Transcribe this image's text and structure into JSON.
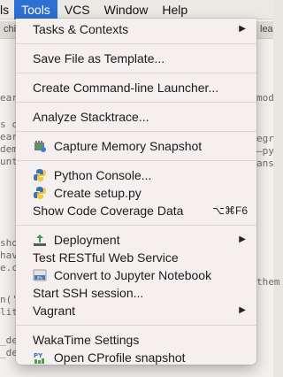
{
  "menubar": {
    "items": [
      "ls",
      "Tools",
      "VCS",
      "Window",
      "Help"
    ]
  },
  "background": {
    "tabs": [
      "chi",
      "lear"
    ],
    "lines": [
      {
        "text": "ear",
        "side": "left"
      },
      {
        "text": "mod",
        "side": "right"
      },
      {
        "text": "s c",
        "side": "left"
      },
      {
        "text": "ear",
        "side": "left"
      },
      {
        "text": "egr",
        "side": "right"
      },
      {
        "text": "dem",
        "side": "left"
      },
      {
        "text": "—py",
        "side": "right"
      },
      {
        "text": "unt",
        "side": "left"
      },
      {
        "text": "ans",
        "side": "right"
      },
      {
        "text": "sho",
        "side": "left"
      },
      {
        "text": "hav",
        "side": "left"
      },
      {
        "text": "them",
        "side": "right"
      },
      {
        "text": "e.c",
        "side": "left"
      },
      {
        "text": "n('",
        "side": "left"
      },
      {
        "text": "lit",
        "side": "left"
      },
      {
        "text": "_de",
        "side": "left"
      },
      {
        "text": "_de",
        "side": "left"
      }
    ]
  },
  "menu": {
    "tasks": "Tasks & Contexts",
    "save_template": "Save File as Template...",
    "cmdline": "Create Command-line Launcher...",
    "stacktrace": "Analyze Stacktrace...",
    "memory": "Capture Memory Snapshot",
    "python_console": "Python Console...",
    "setup_py": "Create setup.py",
    "coverage": "Show Code Coverage Data",
    "coverage_shortcut": "⌥⌘F6",
    "deployment": "Deployment",
    "restful": "Test RESTful Web Service",
    "jupyter": "Convert to Jupyter Notebook",
    "ssh": "Start SSH session...",
    "vagrant": "Vagrant",
    "wakatime": "WakaTime Settings",
    "cprofile": "Open CProfile snapshot",
    "submenu_arrow": "▶"
  },
  "colors": {
    "highlight": "#2d6fd3",
    "menu_bg": "#f6efef"
  }
}
